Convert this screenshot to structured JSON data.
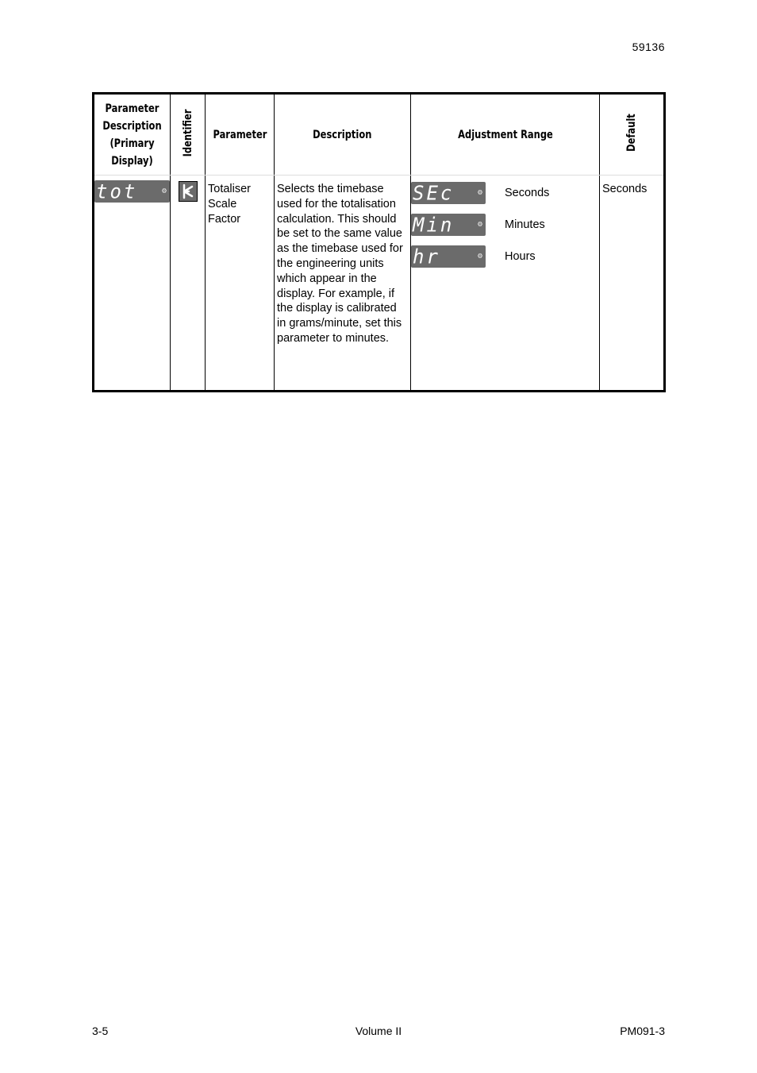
{
  "header": {
    "doc_number": "59136"
  },
  "table": {
    "headers": {
      "primary_display": "Parameter Description (Primary Display)",
      "identifier": "Identifier",
      "parameter": "Parameter",
      "description": "Description",
      "adjustment_range": "Adjustment Range",
      "default": "Default"
    },
    "row": {
      "primary_display": {
        "lcd_text": "tot",
        "annunciator": "display-annunciator-icon"
      },
      "identifier_icon": "totaliser-identifier-icon",
      "parameter": "Totaliser Scale Factor",
      "description": "Selects the timebase used for the totalisation calculation. This should be set to the same value as the timebase used for the engineering units which appear in the display. For example, if the display is calibrated in grams/minute, set this parameter to minutes.",
      "adjustment_range": [
        {
          "lcd_text": "SEc",
          "label": "Seconds"
        },
        {
          "lcd_text": "Min",
          "label": "Minutes"
        },
        {
          "lcd_text": "hr",
          "label": "Hours"
        }
      ],
      "default": "Seconds"
    }
  },
  "footer": {
    "page": "3-5",
    "volume": "Volume II",
    "doc_ref": "PM091-3"
  }
}
